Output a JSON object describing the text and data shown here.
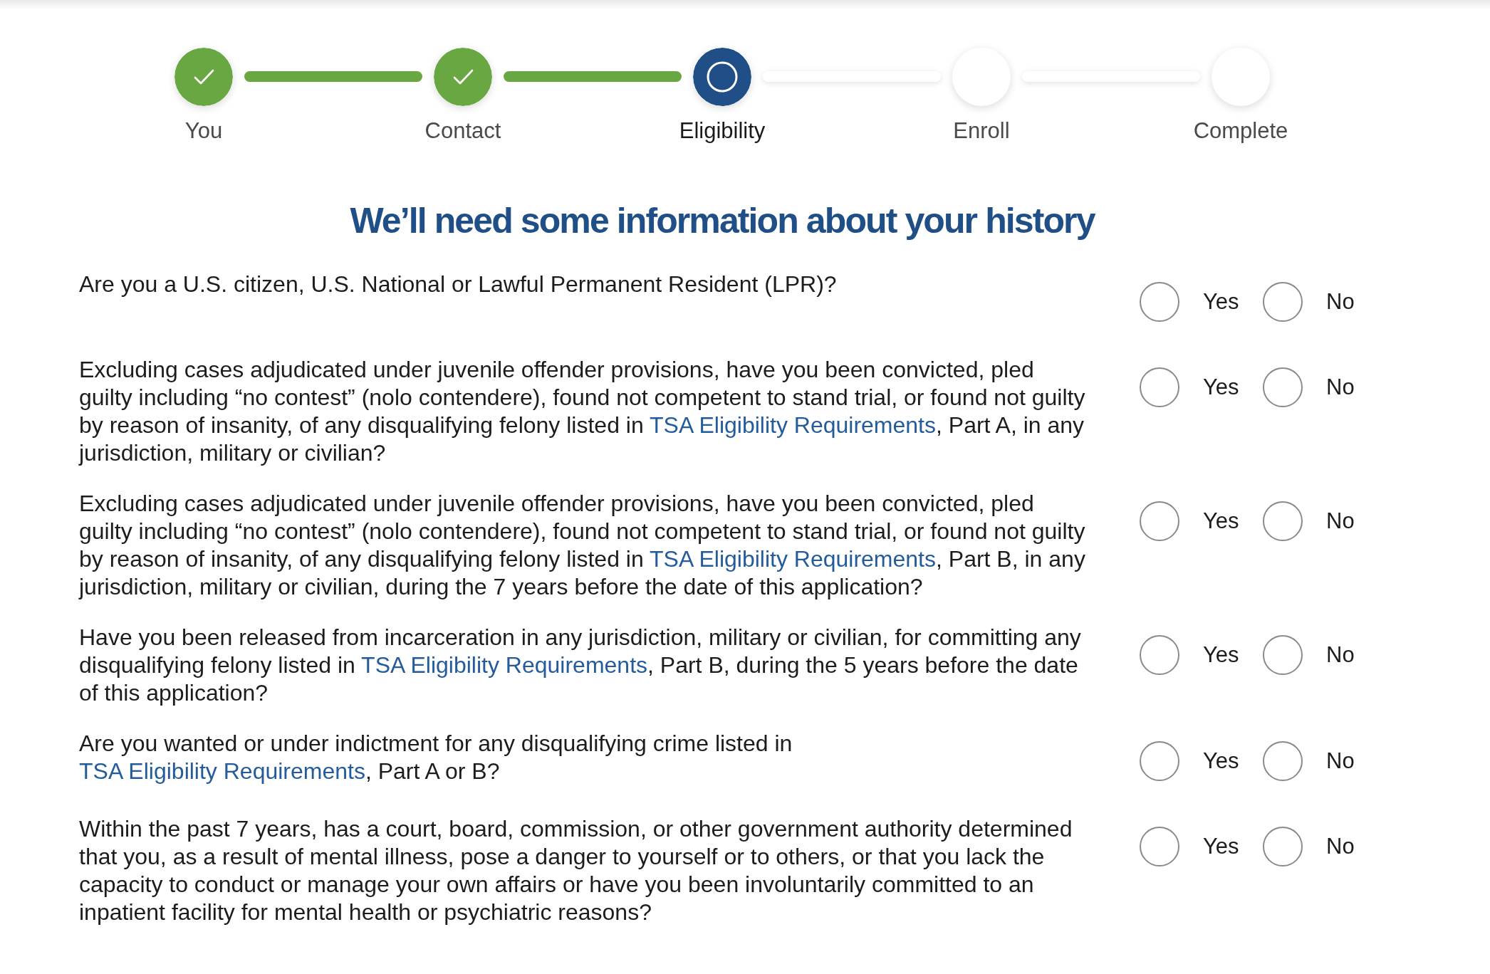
{
  "progress_steps": [
    {
      "label": "You",
      "completed": true,
      "current": false
    },
    {
      "label": "Contact",
      "completed": true,
      "current": false
    },
    {
      "label": "Eligibility",
      "completed": false,
      "current": true
    },
    {
      "label": "Enroll",
      "completed": false,
      "current": false
    },
    {
      "label": "Complete",
      "completed": false,
      "current": false
    }
  ],
  "heading": "We’ll need some information about your history",
  "questions": [
    {
      "parts": [
        {
          "kind": "text",
          "text": "Are you a U.S. citizen, U.S. National or Lawful Permanent Resident (LPR)?"
        }
      ],
      "options": [
        {
          "label": "Yes",
          "selected": false
        },
        {
          "label": "No",
          "selected": false
        }
      ]
    },
    {
      "parts": [
        {
          "kind": "text",
          "text": "Excluding cases adjudicated under juvenile offender provisions, have you been convicted, pled guilty including “no contest” (nolo contendere), found not competent to stand trial, or found not guilty by reason of insanity, of any disqualifying felony listed in "
        },
        {
          "kind": "link",
          "text": "TSA Eligibility Requirements"
        },
        {
          "kind": "text",
          "text": ", Part A, in any jurisdiction, military or civilian?"
        }
      ],
      "options": [
        {
          "label": "Yes",
          "selected": false
        },
        {
          "label": "No",
          "selected": false
        }
      ]
    },
    {
      "parts": [
        {
          "kind": "text",
          "text": "Excluding cases adjudicated under juvenile offender provisions, have you been convicted, pled guilty including “no contest” (nolo contendere), found not competent to stand trial, or found not guilty by reason of insanity, of any disqualifying felony listed in "
        },
        {
          "kind": "link",
          "text": "TSA Eligibility Requirements"
        },
        {
          "kind": "text",
          "text": ", Part B, in any jurisdiction, military or civilian, during the 7 years before the date of this application?"
        }
      ],
      "options": [
        {
          "label": "Yes",
          "selected": false
        },
        {
          "label": "No",
          "selected": false
        }
      ]
    },
    {
      "parts": [
        {
          "kind": "text",
          "text": "Have you been released from incarceration in any jurisdiction, military or civilian, for committing any disqualifying felony listed in "
        },
        {
          "kind": "link",
          "text": "TSA Eligibility Requirements"
        },
        {
          "kind": "text",
          "text": ", Part B, during the 5 years before the date of this application?"
        }
      ],
      "options": [
        {
          "label": "Yes",
          "selected": false
        },
        {
          "label": "No",
          "selected": false
        }
      ]
    },
    {
      "parts": [
        {
          "kind": "text",
          "text": "Are you wanted or under indictment for any disqualifying crime listed in "
        },
        {
          "kind": "link",
          "text": "TSA Eligibility Requirements"
        },
        {
          "kind": "text",
          "text": ", Part A or B?"
        }
      ],
      "options": [
        {
          "label": "Yes",
          "selected": false
        },
        {
          "label": "No",
          "selected": false
        }
      ]
    },
    {
      "parts": [
        {
          "kind": "text",
          "text": "Within the past 7 years, has a court, board, commission, or other government authority determined that you, as a result of mental illness, pose a danger to yourself or to others, or that you lack the capacity to conduct or manage your own affairs or have you been involuntarily committed to an inpatient facility for mental health or psychiatric reasons?"
        }
      ],
      "options": [
        {
          "label": "Yes",
          "selected": false
        },
        {
          "label": "No",
          "selected": false
        }
      ]
    }
  ]
}
